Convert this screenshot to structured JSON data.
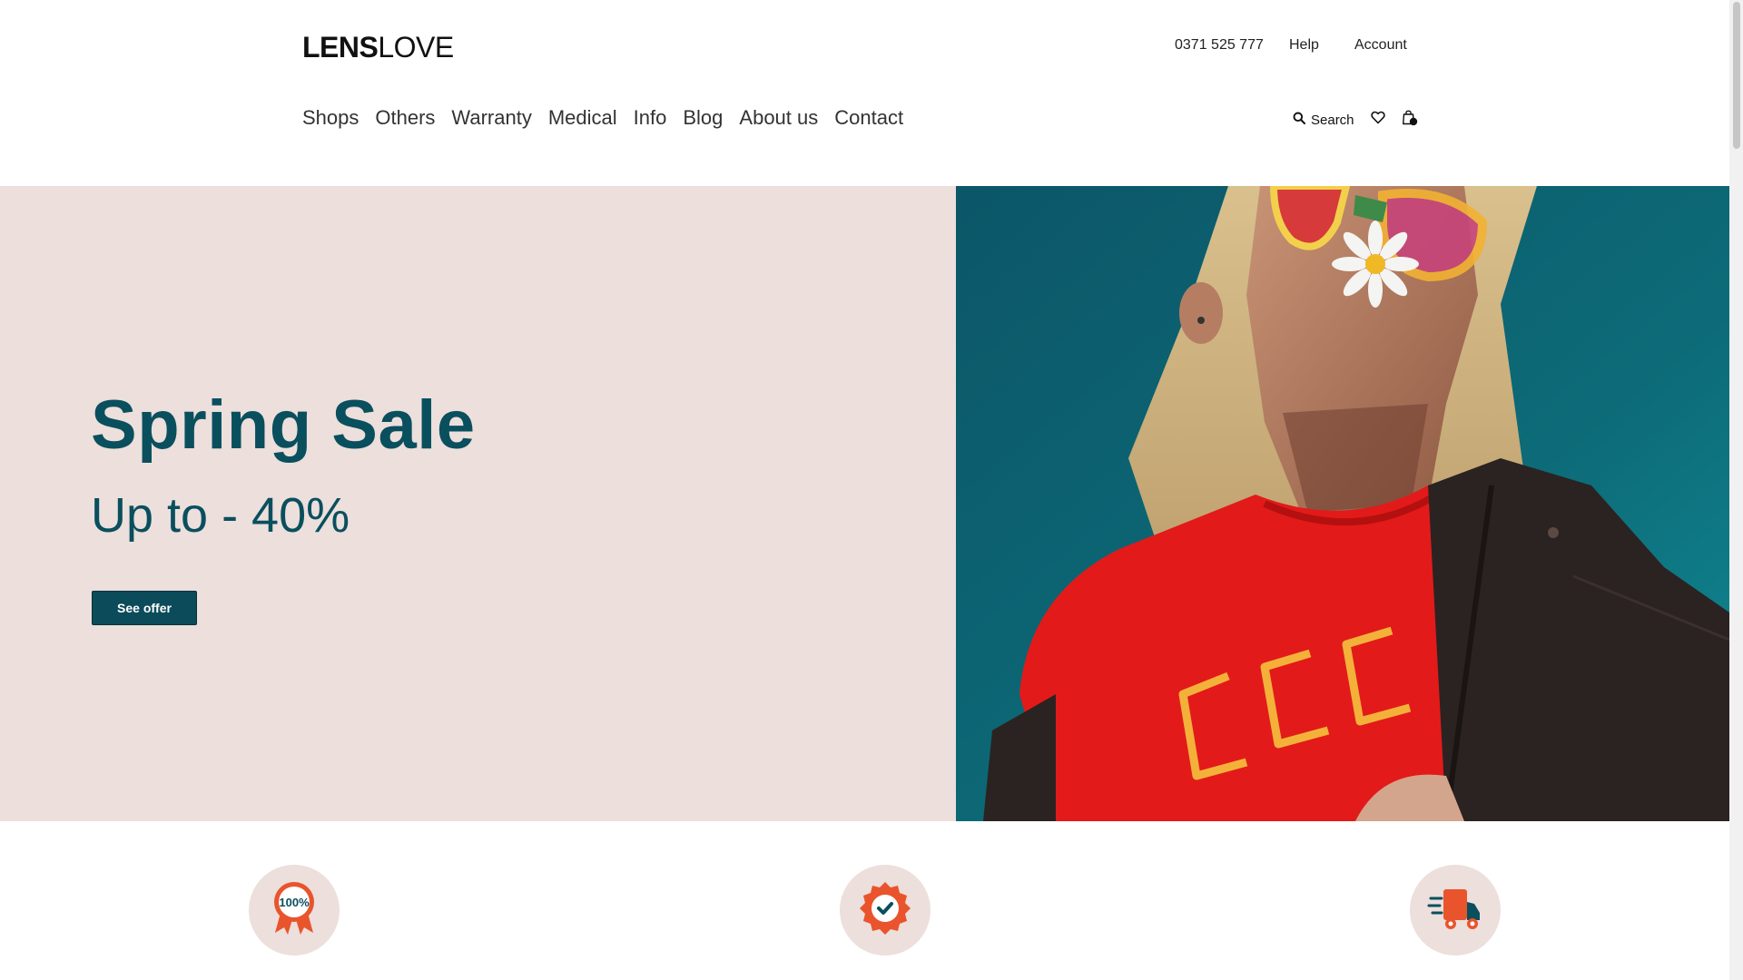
{
  "header": {
    "logo": {
      "bold": "LENS",
      "light": "LOVE"
    },
    "phone": "0371 525 777",
    "help": "Help",
    "account": "Account"
  },
  "nav": {
    "items": [
      "Shops",
      "Others",
      "Warranty",
      "Medical",
      "Info",
      "Blog",
      "About us",
      "Contact"
    ]
  },
  "tools": {
    "search_label": "Search",
    "search_icon": "search-icon",
    "wishlist_icon": "heart-icon",
    "cart_icon": "shopping-bag-icon",
    "cart_count": "0"
  },
  "hero": {
    "title": "Spring Sale",
    "subtitle": "Up to - 40%",
    "button_label": "See offer",
    "image_alt": "woman-with-colorful-sunglasses-and-daisy",
    "colors": {
      "panel_bg": "#ecdfdc",
      "text": "#0a4f5e",
      "button_bg": "#0b4b5a",
      "image_bg": "#0d6776"
    }
  },
  "features": {
    "items": [
      {
        "icon": "guarantee-badge-icon",
        "badge_text": "100%"
      },
      {
        "icon": "verified-seal-icon"
      },
      {
        "icon": "delivery-truck-icon"
      }
    ],
    "colors": {
      "circle_bg": "#ecdfdc",
      "accent": "#e9542c",
      "dark": "#0a4f5e"
    }
  }
}
